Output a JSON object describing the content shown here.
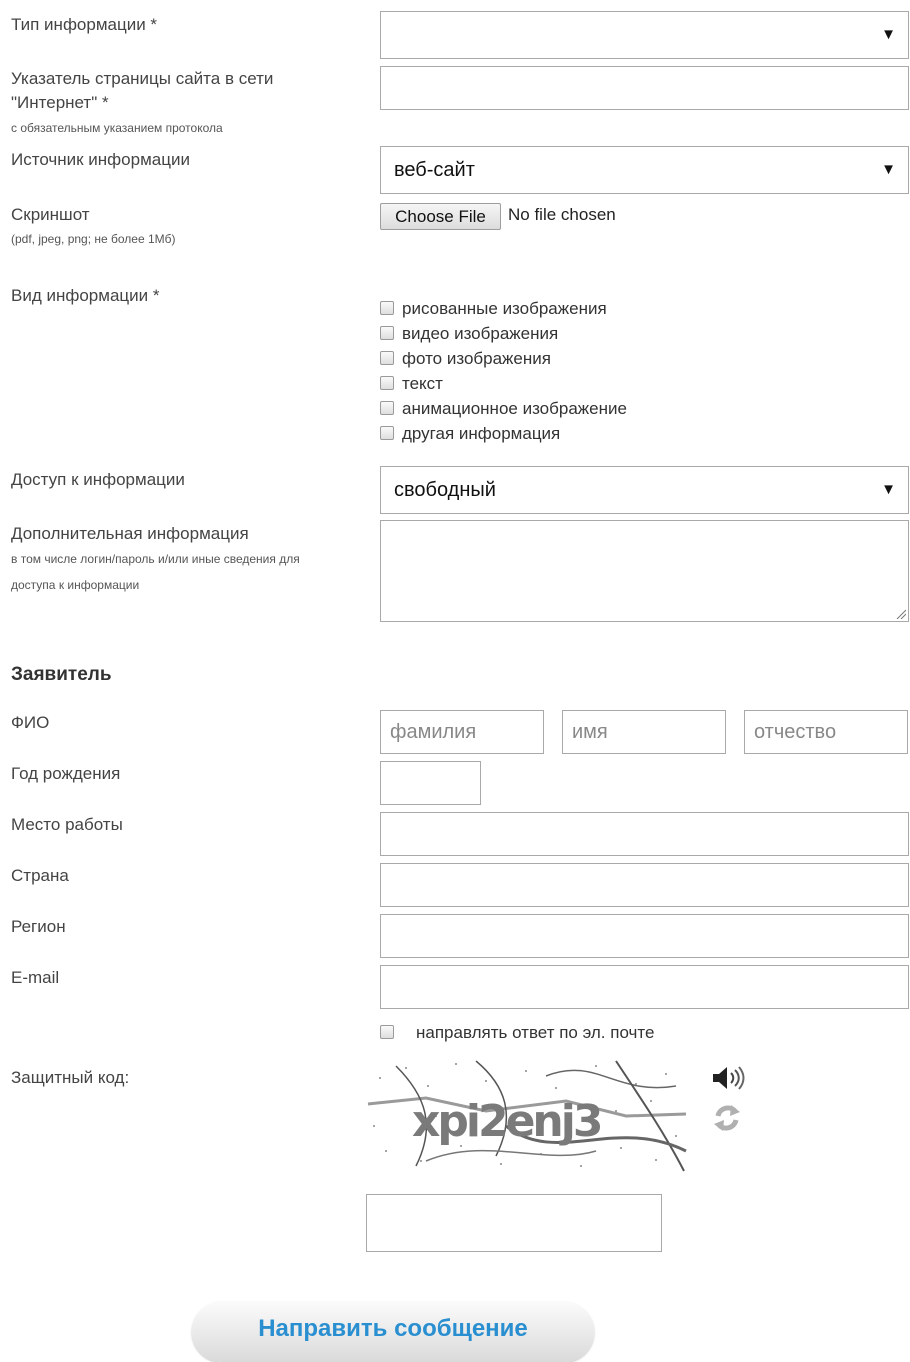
{
  "form": {
    "info_type": {
      "label": "Тип информации *",
      "value": ""
    },
    "page_url": {
      "label": "Указатель страницы сайта в сети \"Интернет\" *",
      "hint": "с обязательным указанием протокола",
      "value": ""
    },
    "source": {
      "label": "Источник информации",
      "value": "веб-сайт"
    },
    "screenshot": {
      "label": "Скриншот",
      "hint": "(pdf, jpeg, png; не более 1Мб)",
      "button": "Choose File",
      "status": "No file chosen"
    },
    "info_kind": {
      "label": "Вид информации *",
      "options": [
        "рисованные изображения",
        "видео изображения",
        "фото изображения",
        "текст",
        "анимационное изображение",
        "другая информация"
      ]
    },
    "access": {
      "label": "Доступ к информации",
      "value": "свободный"
    },
    "extra": {
      "label": "Дополнительная информация",
      "hint": "в том числе логин/пароль и/или иные сведения для доступа к информации",
      "value": ""
    }
  },
  "applicant": {
    "heading": "Заявитель",
    "fio": {
      "label": "ФИО",
      "surname_placeholder": "фамилия",
      "name_placeholder": "имя",
      "patronymic_placeholder": "отчество"
    },
    "birth_year": {
      "label": "Год рождения",
      "value": ""
    },
    "workplace": {
      "label": "Место работы",
      "value": ""
    },
    "country": {
      "label": "Страна",
      "value": ""
    },
    "region": {
      "label": "Регион",
      "value": ""
    },
    "email": {
      "label": "E-mail",
      "value": ""
    },
    "email_reply": {
      "label": "направлять ответ по эл. почте",
      "checked": false
    }
  },
  "captcha": {
    "label": "Защитный код:",
    "image_text": "xpi2enj3",
    "value": "",
    "audio_icon": "speaker-icon",
    "refresh_icon": "refresh-icon"
  },
  "submit_label": "Направить сообщение",
  "colors": {
    "accent": "#2a8fd0",
    "border": "#a9a9a9"
  }
}
